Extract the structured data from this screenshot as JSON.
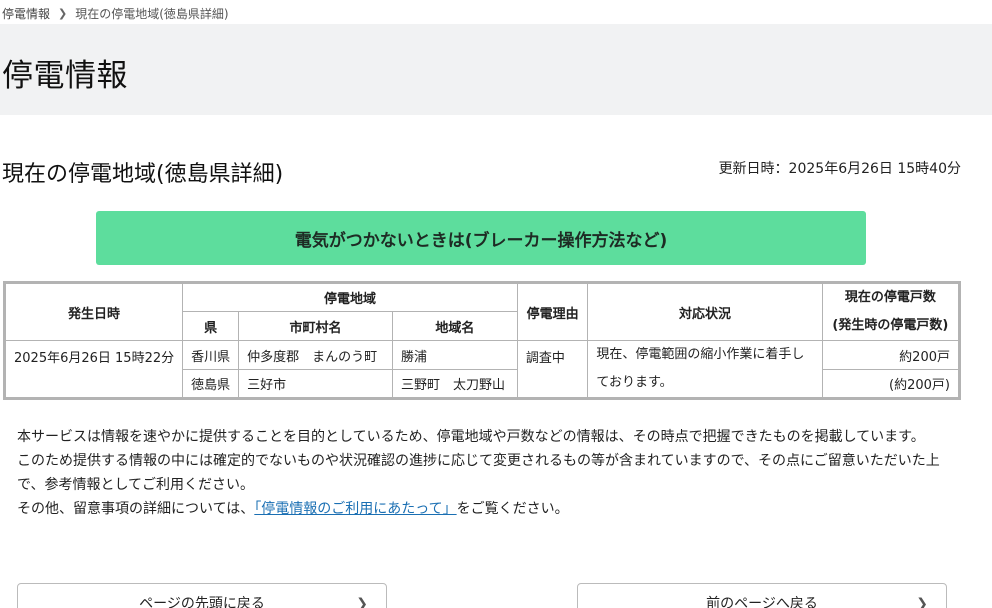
{
  "breadcrumb": {
    "home": "停電情報",
    "current": "現在の停電地域(徳島県詳細)"
  },
  "header": {
    "title": "停電情報"
  },
  "section": {
    "title": "現在の停電地域(徳島県詳細)",
    "updated": "更新日時：2025年6月26日 15時40分"
  },
  "action_button": {
    "label": "電気がつかないときは(ブレーカー操作方法など)"
  },
  "table": {
    "headers": {
      "occurred": "発生日時",
      "area": "停電地域",
      "prefecture": "県",
      "municipality": "市町村名",
      "district": "地域名",
      "reason": "停電理由",
      "status": "対応状況",
      "households_line1": "現在の停電戸数",
      "households_line2": "(発生時の停電戸数)"
    },
    "row": {
      "occurred": "2025年6月26日 15時22分",
      "reason": "調査中",
      "status": "現在、停電範囲の縮小作業に着手しております。",
      "current_households": "約200戸",
      "initial_households": "(約200戸)",
      "areas": [
        {
          "prefecture": "香川県",
          "municipality": "仲多度郡　まんのう町",
          "district": "勝浦"
        },
        {
          "prefecture": "徳島県",
          "municipality": "三好市",
          "district": "三野町　太刀野山"
        }
      ]
    }
  },
  "notice": {
    "line1": "本サービスは情報を速やかに提供することを目的としているため、停電地域や戸数などの情報は、その時点で把握できたものを掲載しています。",
    "line2": "このため提供する情報の中には確定的でないものや状況確認の進捗に応じて変更されるもの等が含まれていますので、その点にご留意いただいた上で、参考情報としてご利用ください。",
    "line3_prefix": "その他、留意事項の詳細については、",
    "line3_link": "「停電情報のご利用にあたって」",
    "line3_suffix": "をご覧ください。"
  },
  "nav": {
    "top_label": "ページの先頭に戻る",
    "back_label": "前のページへ戻る",
    "chevron": "chevron-right-icon"
  }
}
